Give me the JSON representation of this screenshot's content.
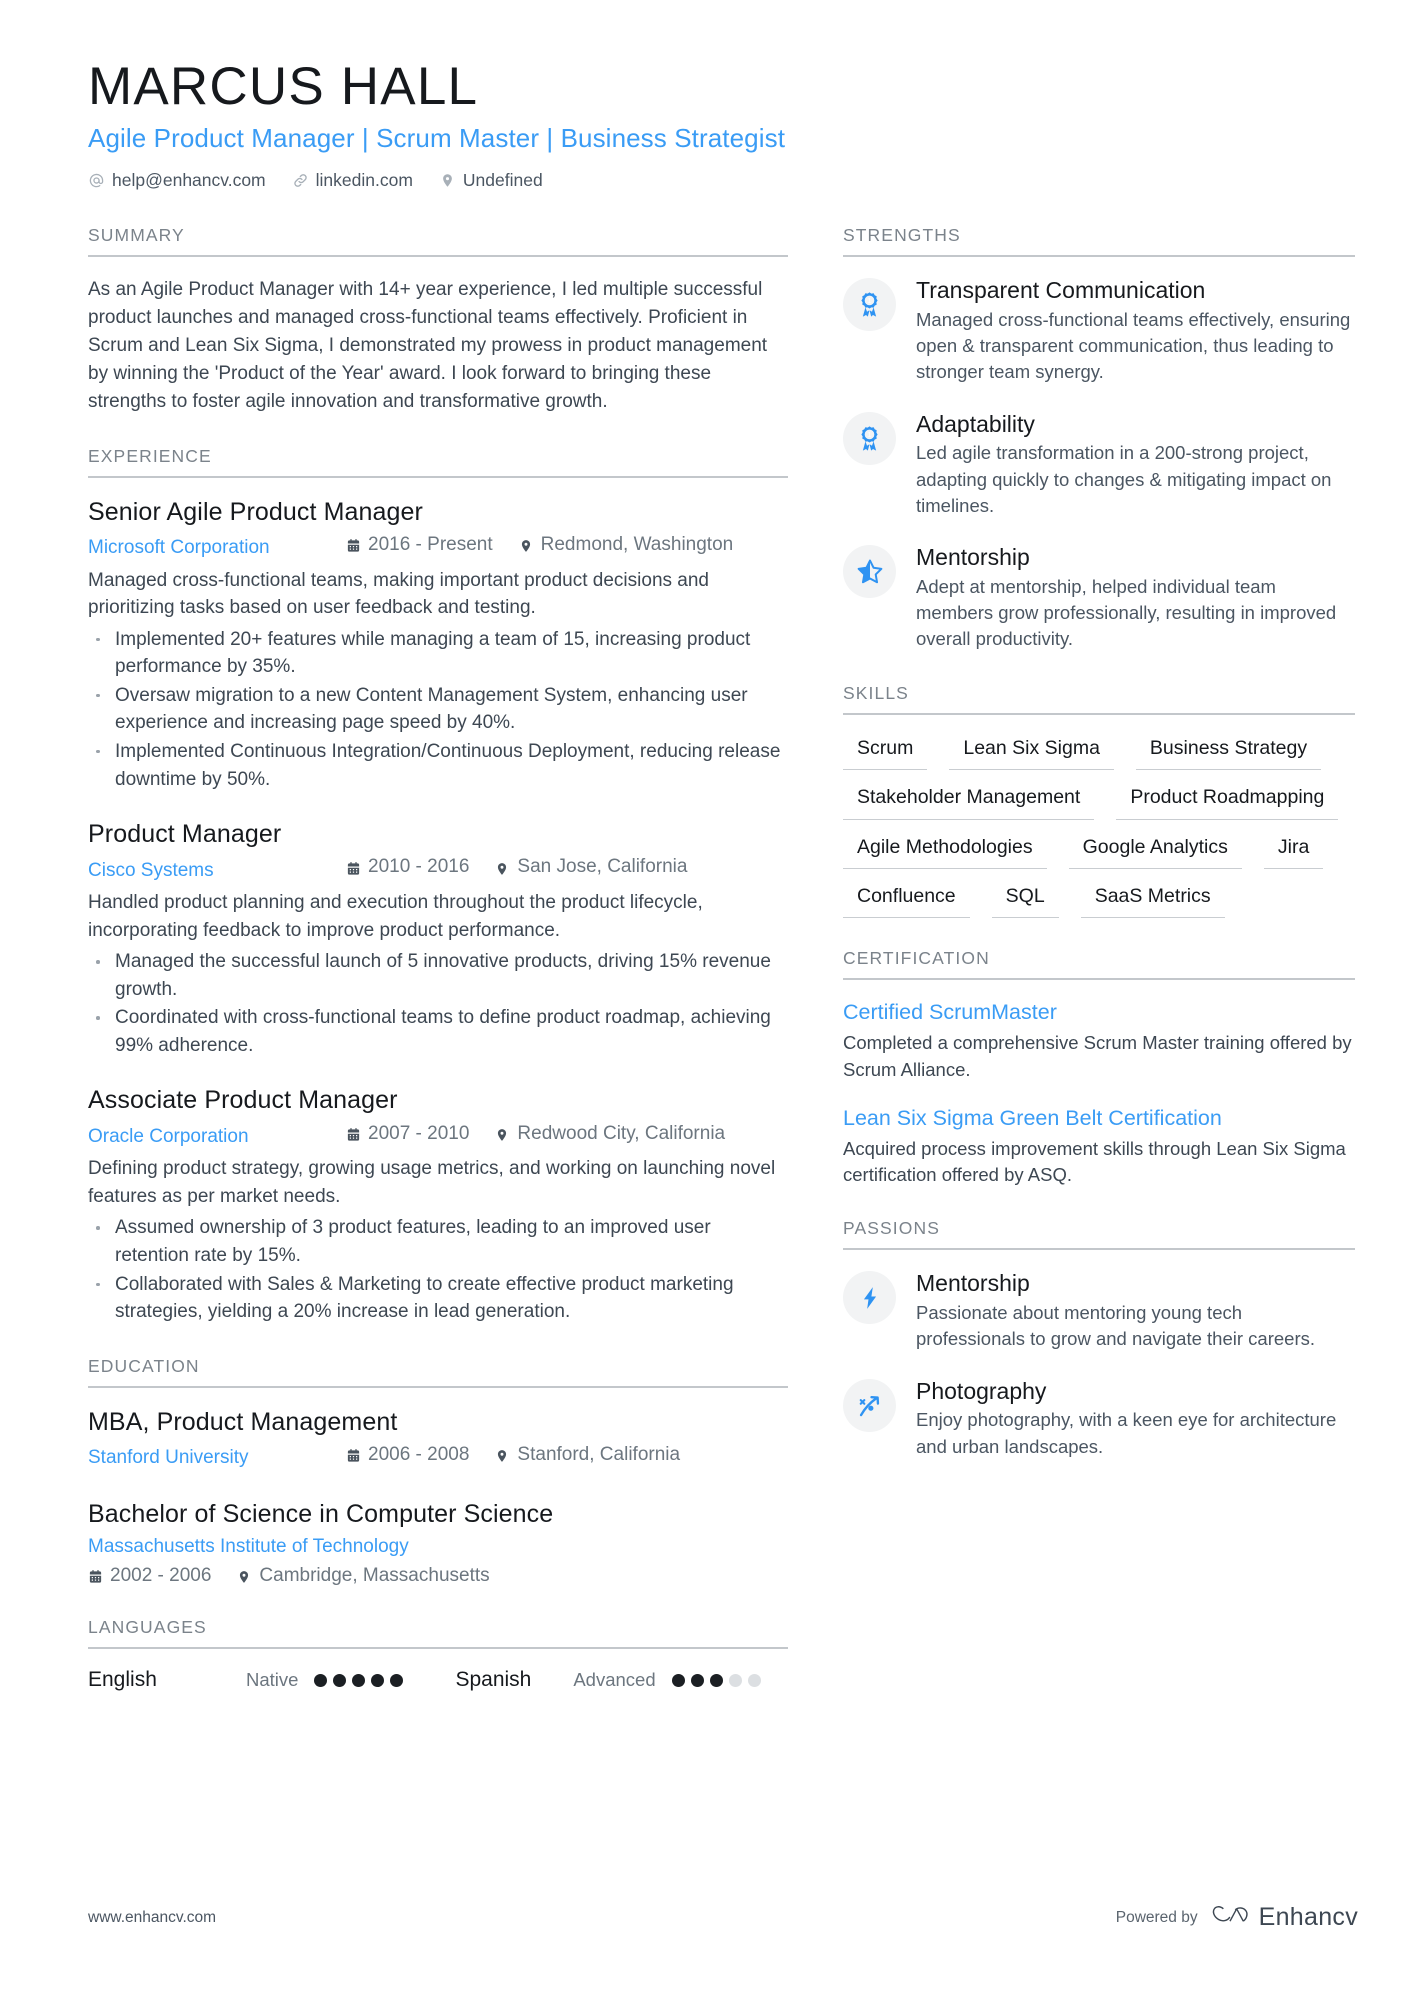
{
  "header": {
    "name": "MARCUS HALL",
    "headline": "Agile Product Manager | Scrum Master | Business Strategist",
    "contacts": [
      {
        "icon": "at-icon",
        "text": "help@enhancv.com"
      },
      {
        "icon": "link-icon",
        "text": "linkedin.com"
      },
      {
        "icon": "location-pin-icon",
        "text": "Undefined"
      }
    ]
  },
  "summary": {
    "title": "SUMMARY",
    "text": "As an Agile Product Manager with 14+ year experience, I led multiple successful product launches and managed cross-functional teams effectively. Proficient in Scrum and Lean Six Sigma, I demonstrated my prowess in product management by winning the 'Product of the Year' award. I look forward to bringing these strengths to foster agile innovation and transformative growth."
  },
  "experience": {
    "title": "EXPERIENCE",
    "entries": [
      {
        "role": "Senior Agile Product Manager",
        "company": "Microsoft Corporation",
        "dates": "2016 - Present",
        "location": "Redmond, Washington",
        "description": "Managed cross-functional teams, making important product decisions and prioritizing tasks based on user feedback and testing.",
        "bullets": [
          "Implemented 20+ features while managing a team of 15, increasing product performance by 35%.",
          "Oversaw migration to a new Content Management System, enhancing user experience and increasing page speed by 40%.",
          "Implemented Continuous Integration/Continuous Deployment, reducing release downtime by 50%."
        ]
      },
      {
        "role": "Product Manager",
        "company": "Cisco Systems",
        "dates": "2010 - 2016",
        "location": "San Jose, California",
        "description": "Handled product planning and execution throughout the product lifecycle, incorporating feedback to improve product performance.",
        "bullets": [
          "Managed the successful launch of 5 innovative products, driving 15% revenue growth.",
          "Coordinated with cross-functional teams to define product roadmap, achieving 99% adherence."
        ]
      },
      {
        "role": "Associate Product Manager",
        "company": "Oracle Corporation",
        "dates": "2007 - 2010",
        "location": "Redwood City, California",
        "description": "Defining product strategy, growing usage metrics, and working on launching novel features as per market needs.",
        "bullets": [
          "Assumed ownership of 3 product features, leading to an improved user retention rate by 15%.",
          "Collaborated with Sales & Marketing to create effective product marketing strategies, yielding a 20% increase in lead generation."
        ]
      }
    ]
  },
  "education": {
    "title": "EDUCATION",
    "entries": [
      {
        "degree": "MBA, Product Management",
        "school": "Stanford University",
        "dates": "2006 - 2008",
        "location": "Stanford, California",
        "stacked": false
      },
      {
        "degree": "Bachelor of Science in Computer Science",
        "school": "Massachusetts Institute of Technology",
        "dates": "2002 - 2006",
        "location": "Cambridge, Massachusetts",
        "stacked": true
      }
    ]
  },
  "languages": {
    "title": "LANGUAGES",
    "items": [
      {
        "name": "English",
        "level": "Native",
        "filled": 5,
        "total": 5
      },
      {
        "name": "Spanish",
        "level": "Advanced",
        "filled": 3,
        "total": 5
      }
    ]
  },
  "strengths": {
    "title": "STRENGTHS",
    "items": [
      {
        "icon": "award-ribbon-icon",
        "title": "Transparent Communication",
        "description": "Managed cross-functional teams effectively, ensuring open & transparent communication, thus leading to stronger team synergy."
      },
      {
        "icon": "award-ribbon-icon",
        "title": "Adaptability",
        "description": "Led agile transformation in a 200-strong project, adapting quickly to changes & mitigating impact on timelines."
      },
      {
        "icon": "half-star-icon",
        "title": "Mentorship",
        "description": "Adept at mentorship, helped individual team members grow professionally, resulting in improved overall productivity."
      }
    ]
  },
  "skills": {
    "title": "SKILLS",
    "items": [
      "Scrum",
      "Lean Six Sigma",
      "Business Strategy",
      "Stakeholder Management",
      "Product Roadmapping",
      "Agile Methodologies",
      "Google Analytics",
      "Jira",
      "Confluence",
      "SQL",
      "SaaS Metrics"
    ]
  },
  "certification": {
    "title": "CERTIFICATION",
    "items": [
      {
        "name": "Certified ScrumMaster",
        "description": "Completed a comprehensive Scrum Master training offered by Scrum Alliance."
      },
      {
        "name": "Lean Six Sigma Green Belt Certification",
        "description": "Acquired process improvement skills through Lean Six Sigma certification offered by ASQ."
      }
    ]
  },
  "passions": {
    "title": "PASSIONS",
    "items": [
      {
        "icon": "lightning-bolt-icon",
        "title": "Mentorship",
        "description": "Passionate about mentoring young tech professionals to grow and navigate their careers."
      },
      {
        "icon": "strategy-arrow-icon",
        "title": "Photography",
        "description": "Enjoy photography, with a keen eye for architecture and urban landscapes."
      }
    ]
  },
  "footer": {
    "website": "www.enhancv.com",
    "powered_by_label": "Powered by",
    "brand_name": "Enhancv"
  },
  "colors": {
    "accent": "#3a9cf5",
    "heading": "#16191d",
    "body": "#3d4752",
    "muted": "#7b838b",
    "rule": "#c3c7cb"
  }
}
